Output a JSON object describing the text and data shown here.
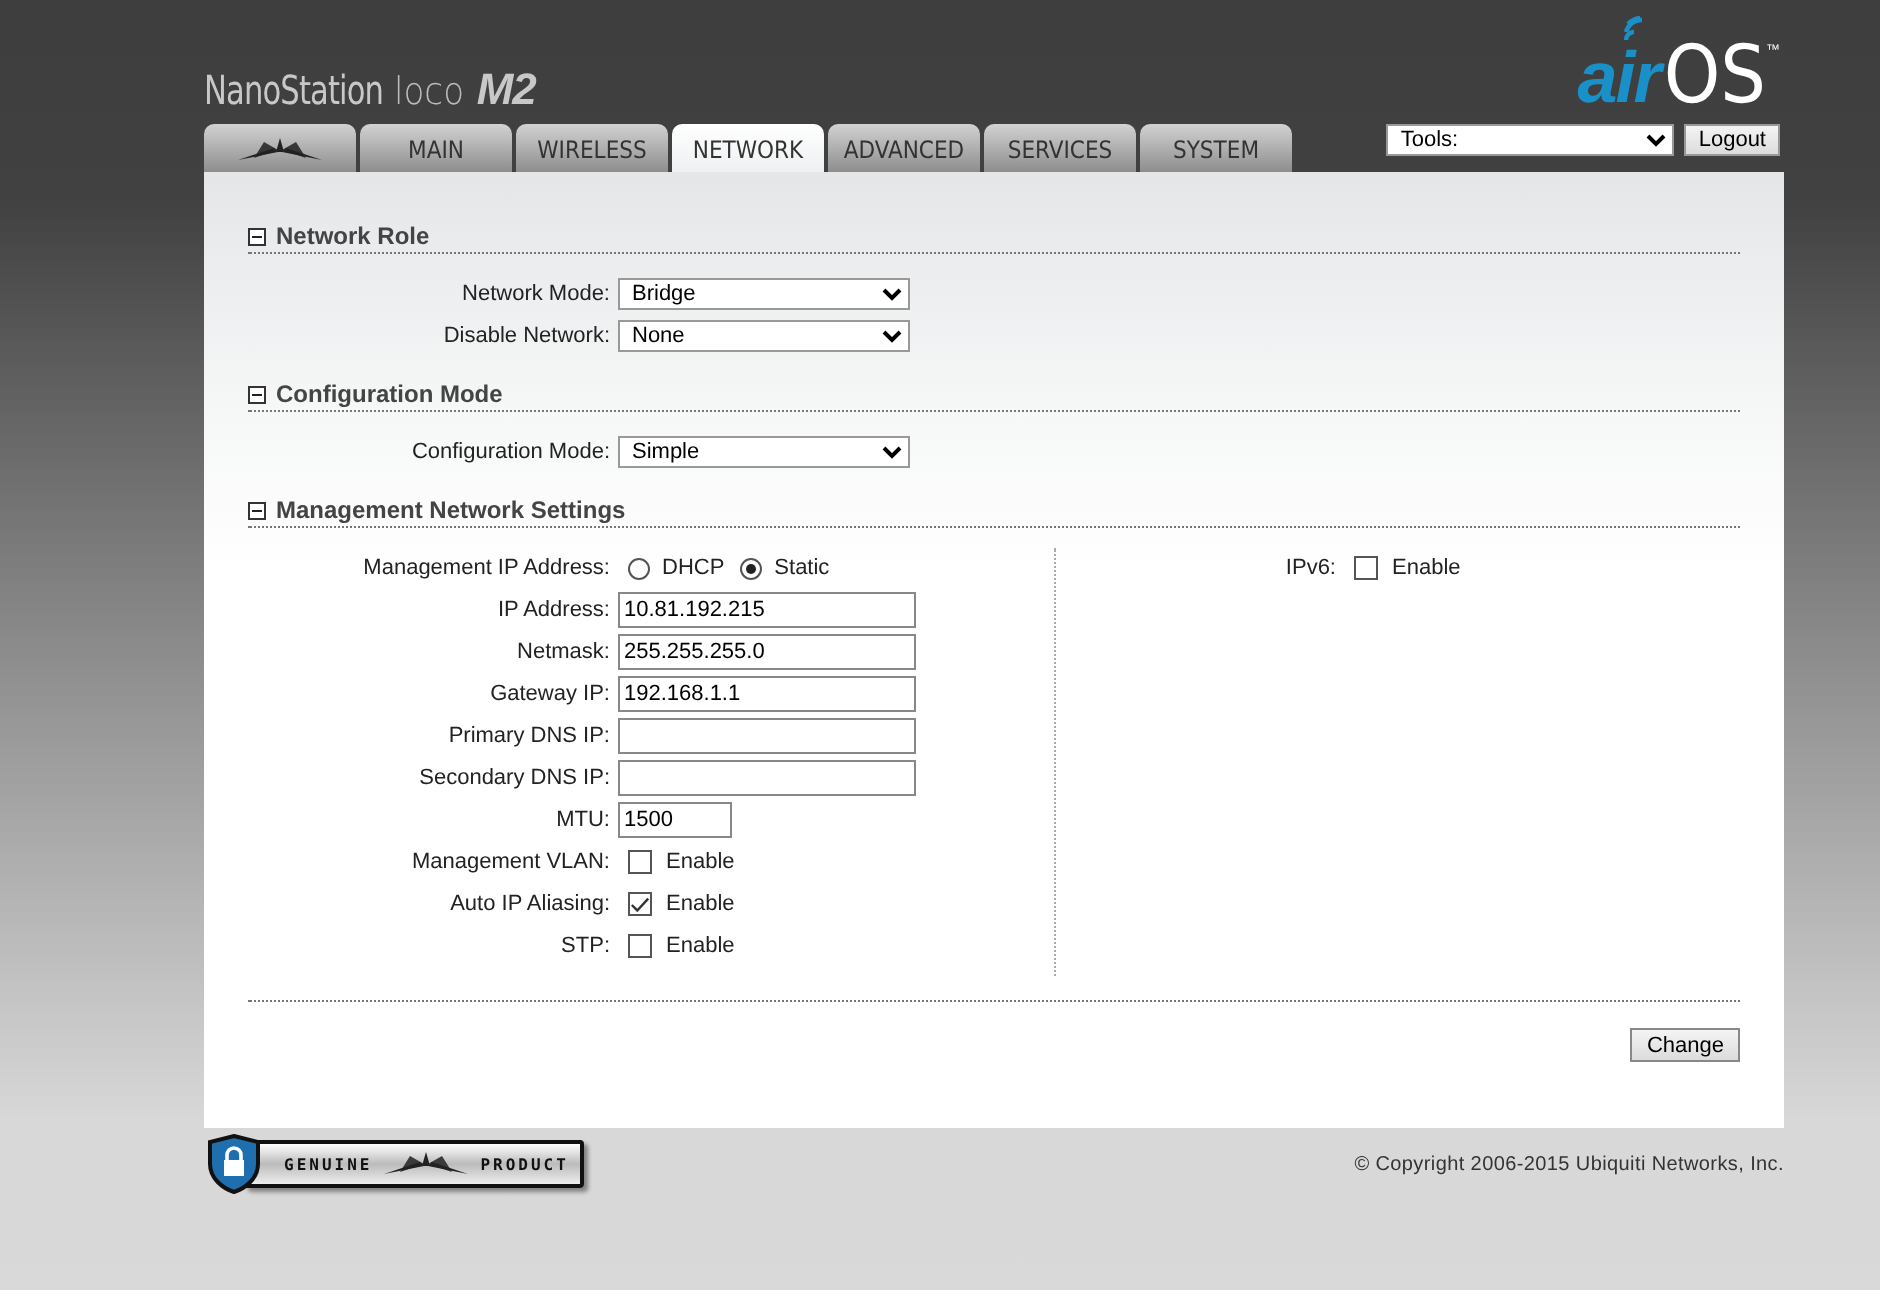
{
  "product": {
    "name": "NanoStation",
    "model": "loco",
    "version": "M2"
  },
  "brand": {
    "prefix": "air",
    "suffix": "OS",
    "mark": "™"
  },
  "tabs": [
    {
      "kind": "logo",
      "selected": false
    },
    {
      "kind": "text",
      "label": "MAIN",
      "selected": false
    },
    {
      "kind": "text",
      "label": "WIRELESS",
      "selected": false
    },
    {
      "kind": "text",
      "label": "NETWORK",
      "selected": true
    },
    {
      "kind": "text",
      "label": "ADVANCED",
      "selected": false
    },
    {
      "kind": "text",
      "label": "SERVICES",
      "selected": false
    },
    {
      "kind": "text",
      "label": "SYSTEM",
      "selected": false
    }
  ],
  "tools": {
    "value": "Tools:"
  },
  "logout": "Logout",
  "sections": [
    {
      "title": "Network Role",
      "expanded": true,
      "rows": [
        {
          "kind": "select",
          "label": "Network Mode:",
          "value": "Bridge"
        },
        {
          "kind": "select",
          "label": "Disable Network:",
          "value": "None"
        }
      ]
    },
    {
      "title": "Configuration Mode",
      "expanded": true,
      "rows": [
        {
          "kind": "select",
          "label": "Configuration Mode:",
          "value": "Simple"
        }
      ]
    },
    {
      "title": "Management Network Settings",
      "expanded": true,
      "rows": [
        {
          "kind": "radio",
          "label": "Management IP Address:",
          "options": [
            {
              "label": "DHCP",
              "selected": false
            },
            {
              "label": "Static",
              "selected": true
            }
          ]
        },
        {
          "kind": "text",
          "label": "IP Address:",
          "value": "10.81.192.215"
        },
        {
          "kind": "text",
          "label": "Netmask:",
          "value": "255.255.255.0"
        },
        {
          "kind": "text",
          "label": "Gateway IP:",
          "value": "192.168.1.1"
        },
        {
          "kind": "text",
          "label": "Primary DNS IP:"
        },
        {
          "kind": "text",
          "label": "Secondary DNS IP:"
        },
        {
          "kind": "short",
          "label": "MTU:",
          "value": "1500"
        },
        {
          "kind": "checkbox",
          "label": "Management VLAN:",
          "text": "Enable",
          "checked": false
        },
        {
          "kind": "checkbox",
          "label": "Auto IP Aliasing:",
          "text": "Enable",
          "checked": true
        },
        {
          "kind": "checkbox",
          "label": "STP:",
          "text": "Enable",
          "checked": false
        }
      ],
      "side_rows": [
        {
          "kind": "checkbox",
          "label": "IPv6:",
          "text": "Enable",
          "checked": false
        }
      ]
    }
  ],
  "button": "Change",
  "footer": {
    "badge_left": "GENUINE",
    "badge_right": "PRODUCT",
    "copyright": "© Copyright 2006-2015 Ubiquiti Networks, Inc."
  }
}
